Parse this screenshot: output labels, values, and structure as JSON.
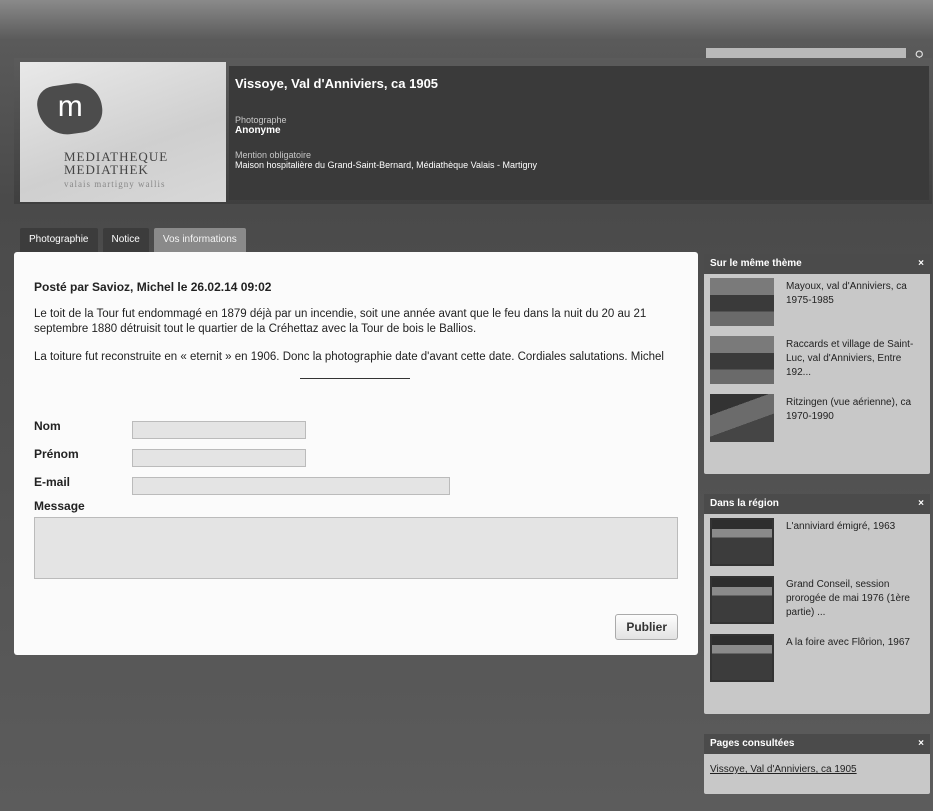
{
  "search": {
    "placeholder": ""
  },
  "logo": {
    "mark": "m",
    "line1": "MEDIATHEQUE",
    "line2": "MEDIATHEK",
    "sub": "valais martigny wallis"
  },
  "meta": {
    "title": "Vissoye, Val d'Anniviers, ca 1905",
    "photographer_label": "Photographe",
    "photographer": "Anonyme",
    "credit_label": "Mention obligatoire",
    "credit": "Maison hospitalière du Grand-Saint-Bernard, Médiathèque Valais - Martigny"
  },
  "tabs": [
    "Photographie",
    "Notice",
    "Vos informations"
  ],
  "post": {
    "header": "Posté par Savioz, Michel le 26.02.14 09:02",
    "p1": "Le toit de la Tour fut endommagé en 1879 déjà par un incendie, soit une année avant que le feu dans la nuit du 20 au 21 septembre 1880 détruisit tout le quartier de la Créhettaz avec la Tour de bois le Ballios.",
    "p2": "La toiture fut reconstruite en « eternit » en 1906. Donc la photographie date d'avant cette date. Cordiales salutations. Michel"
  },
  "form": {
    "nom": "Nom",
    "prenom": "Prénom",
    "email": "E-mail",
    "message": "Message",
    "submit": "Publier"
  },
  "panels": {
    "theme": {
      "title": "Sur le même thème",
      "close": "×",
      "items": [
        "Mayoux, val d'Anniviers, ca 1975-1985",
        "Raccards et village de Saint-Luc, val d'Anniviers, Entre 192...",
        "Ritzingen (vue aérienne), ca 1970-1990"
      ]
    },
    "region": {
      "title": "Dans la région",
      "close": "×",
      "items": [
        "L'anniviard émigré, 1963",
        "Grand Conseil, session prorogée de mai 1976 (1ère partie) ...",
        "A la foire avec Flôrion, 1967"
      ]
    },
    "visited": {
      "title": "Pages consultées",
      "close": "×",
      "link": "Vissoye, Val d'Anniviers, ca 1905"
    }
  }
}
